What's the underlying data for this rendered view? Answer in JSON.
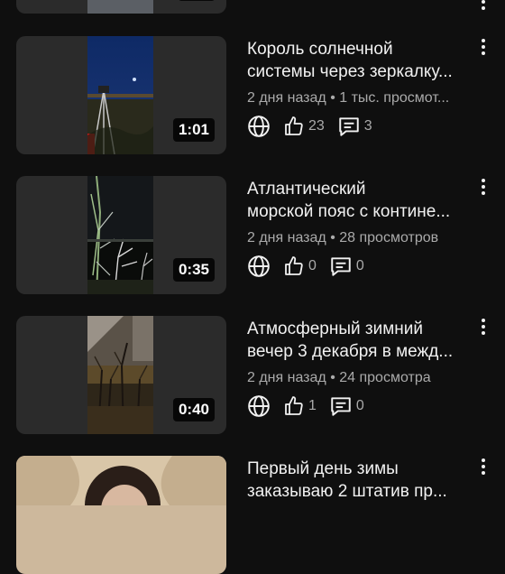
{
  "videos": [
    {
      "title_line1": "Король солнечной",
      "title_line2": "системы через зеркалку...",
      "meta": "2 дня назад • 1 тыс. просмот...",
      "duration": "1:01",
      "likes": "23",
      "comments": "3"
    },
    {
      "title_line1": "Атлантический",
      "title_line2": "морской пояс с контине...",
      "meta": "2 дня назад • 28 просмотров",
      "duration": "0:35",
      "likes": "0",
      "comments": "0"
    },
    {
      "title_line1": "Атмосферный зимний",
      "title_line2": "вечер 3 декабря в межд...",
      "meta": "2 дня назад • 24 просмотра",
      "duration": "0:40",
      "likes": "1",
      "comments": "0"
    },
    {
      "title_line1": "Первый день зимы",
      "title_line2": "заказываю 2 штатив пр..."
    }
  ],
  "icons": {
    "visibility": "globe-icon",
    "likes": "thumbs-up-icon",
    "comments": "comment-icon",
    "menu": "more-vertical-icon"
  }
}
